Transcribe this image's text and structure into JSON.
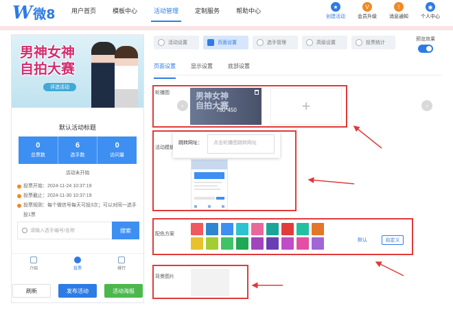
{
  "brand": {
    "logo_mark": "W",
    "logo_text": "微8"
  },
  "nav": [
    {
      "label": "用户首页",
      "active": false
    },
    {
      "label": "模板中心",
      "active": false
    },
    {
      "label": "活动管理",
      "active": true
    },
    {
      "label": "定制服务",
      "active": false
    },
    {
      "label": "帮助中心",
      "active": false
    }
  ],
  "top_actions": [
    {
      "label": "创建活动",
      "icon": "star-icon",
      "glyph": "★",
      "color": "#2d7be5"
    },
    {
      "label": "会员升级",
      "icon": "vip-icon",
      "glyph": "V",
      "color": "#f08a24"
    },
    {
      "label": "消息通知",
      "icon": "bell-icon",
      "glyph": "!",
      "color": "#f08a24"
    },
    {
      "label": "个人中心",
      "icon": "user-icon",
      "glyph": "◉",
      "color": "#2d7be5"
    }
  ],
  "preview": {
    "banner_title_line1": "男神女神",
    "banner_title_line2": "自拍大赛",
    "banner_tag": "评选活动",
    "activity_title": "默认活动标题",
    "stats": [
      {
        "value": "0",
        "label": "总票数"
      },
      {
        "value": "6",
        "label": "选手数"
      },
      {
        "value": "0",
        "label": "访问量"
      }
    ],
    "status": "活动未开始",
    "info": [
      "投票开始：2024-11-24 10:37:19",
      "投票截止：2024-11-30 10:37:19",
      "投票规则：每个微信号每天可投3次；可以对同一选手投1票"
    ],
    "search_placeholder": "请输入选手编号/名称",
    "search_button": "搜索",
    "tabs": [
      {
        "label": "介绍",
        "active": false
      },
      {
        "label": "投票",
        "active": true
      },
      {
        "label": "排行",
        "active": false
      }
    ]
  },
  "actions": {
    "refresh": "刷新",
    "publish": "发布活动",
    "poster": "活动海报"
  },
  "steps": [
    {
      "label": "活动设置",
      "active": false
    },
    {
      "label": "页面设置",
      "active": true
    },
    {
      "label": "选手管理",
      "active": false
    },
    {
      "label": "高级设置",
      "active": false
    },
    {
      "label": "投票统计",
      "active": false
    }
  ],
  "preview_toggle": {
    "label": "预览效果",
    "on": true
  },
  "subtabs": [
    {
      "label": "页面设置",
      "active": true
    },
    {
      "label": "显示设置",
      "active": false
    },
    {
      "label": "底部设置",
      "active": false
    }
  ],
  "carousel": {
    "label": "轮播图",
    "image_title_line1": "男神女神",
    "image_title_line2": "自拍大赛",
    "image_size": "750*450",
    "add_symbol": "+",
    "prev_glyph": "‹",
    "next_glyph": "›"
  },
  "template": {
    "label": "活动模板"
  },
  "popup": {
    "label": "跳转网址：",
    "placeholder": "点击轮播图跳转网址"
  },
  "palette": {
    "label": "配色方案",
    "row1": [
      "#f0595e",
      "#2f86cf",
      "#3d8ff2",
      "#2cc3d0",
      "#e8689a",
      "#1aa596",
      "#e33b3b",
      "#24bfa0",
      "#e37627"
    ],
    "row2": [
      "#e9c22b",
      "#a4cc33",
      "#41c266",
      "#20a856",
      "#a145bd",
      "#6a3fb5",
      "#c24bc8",
      "#e64ea3",
      "#a066d6"
    ],
    "default_label": "默认",
    "custom_label": "自定义"
  },
  "background": {
    "label": "背景图片"
  }
}
